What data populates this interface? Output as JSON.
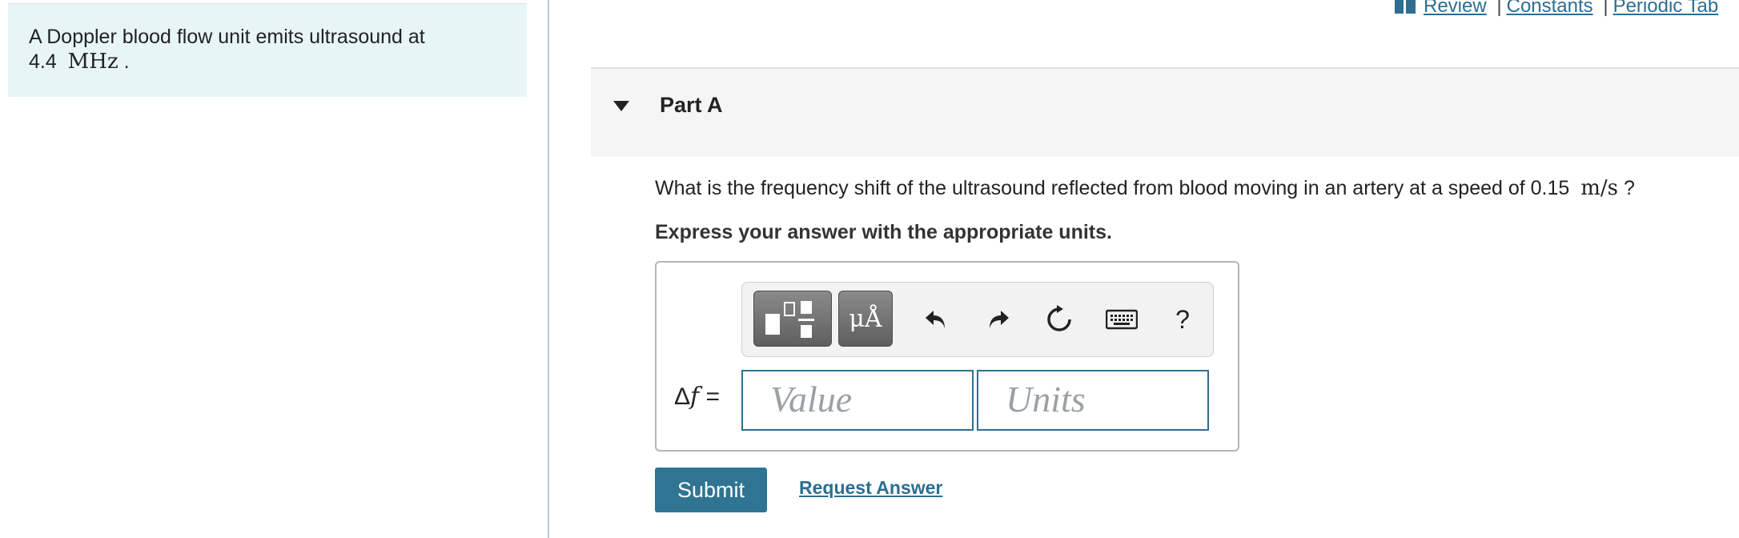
{
  "problem": {
    "text": "A Doppler blood flow unit emits ultrasound at",
    "value": "4.4",
    "unit": "MHz",
    "end": "."
  },
  "top_links": {
    "review": "Review",
    "constants": "Constants",
    "periodic": "Periodic Tab",
    "separator": "|"
  },
  "part": {
    "title": "Part A"
  },
  "question": {
    "text": "What is the frequency shift of the ultrasound reflected from blood moving in an artery at a speed of 0.15",
    "unit": "m/s",
    "end": "?"
  },
  "instruction": "Express your answer with the appropriate units.",
  "toolbar": {
    "units_label": "μÅ",
    "help_label": "?"
  },
  "answer": {
    "label_delta": "Δ",
    "label_var": "f",
    "label_eq": "=",
    "value_placeholder": "Value",
    "units_placeholder": "Units"
  },
  "actions": {
    "submit": "Submit",
    "request": "Request Answer"
  }
}
